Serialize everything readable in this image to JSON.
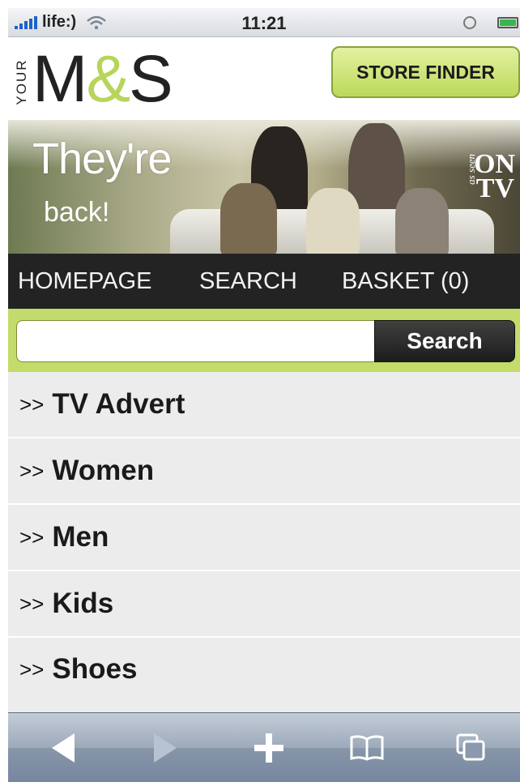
{
  "status": {
    "carrier": "life:)",
    "time": "11:21"
  },
  "header": {
    "logo_prefix": "YOUR",
    "logo_m": "M",
    "logo_amp": "&",
    "logo_s": "S",
    "store_finder": "STORE FINDER"
  },
  "banner": {
    "title": "They're",
    "subtitle": "back!",
    "on_tv": "ON TV",
    "as_seen": "as seen"
  },
  "nav": {
    "homepage": "HOMEPAGE",
    "search": "SEARCH",
    "basket": "BASKET (0)"
  },
  "search": {
    "value": "",
    "placeholder": "",
    "button": "Search"
  },
  "menu": {
    "chevron": ">>",
    "items": [
      {
        "label": "TV Advert"
      },
      {
        "label": "Women"
      },
      {
        "label": "Men"
      },
      {
        "label": "Kids"
      },
      {
        "label": "Shoes"
      }
    ]
  },
  "toolbar": {
    "icons": [
      "back-icon",
      "forward-icon",
      "add-bookmark-icon",
      "bookmarks-icon",
      "pages-icon"
    ]
  },
  "colors": {
    "accent_green": "#c3db6a",
    "nav_dark": "#232323",
    "logo_amp": "#b7d55a"
  }
}
